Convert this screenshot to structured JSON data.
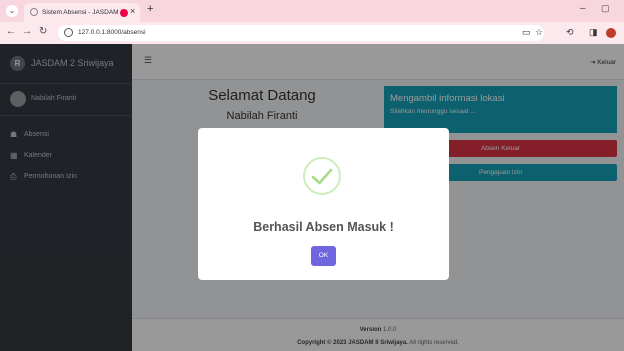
{
  "browser": {
    "tab_title": "Sistem Absensi - JASDAM I",
    "url": "127.0.0.1:8000/absensi",
    "new_tab_glyph": "+",
    "close_glyph": "×"
  },
  "sidebar": {
    "brand": "JASDAM 2 Sriwijaya",
    "brand_logo": "R",
    "user": "Nabilah Firanti",
    "items": [
      {
        "label": "Absensi",
        "icon": "users-icon",
        "glyph": "☗"
      },
      {
        "label": "Kalender",
        "icon": "calendar-icon",
        "glyph": "▦"
      },
      {
        "label": "Permohonan Izin",
        "icon": "printer-icon",
        "glyph": "⎙"
      }
    ]
  },
  "topnav": {
    "logout_label": "Keluar",
    "logout_glyph": "⇥"
  },
  "welcome": {
    "title": "Selamat Datang",
    "name": "Nabilah Firanti"
  },
  "location_card": {
    "title": "Mengambil informasi lokasi",
    "subtitle": "Silahkan menunggu sesaat ..."
  },
  "buttons": {
    "absen_keluar": "Absen Keluar",
    "pengajuan_izin": "Pengajuan Izin"
  },
  "footer": {
    "version_label": "Version",
    "version_value": "1.0.0",
    "copyright_prefix": "Copyright © 2023",
    "copyright_org": "JASDAM II Sriwijaya.",
    "copyright_suffix": "All rights reserved."
  },
  "modal": {
    "title": "Berhasil Absen Masuk !",
    "ok_label": "OK"
  },
  "colors": {
    "sidebar": "#343a40",
    "info": "#17a2b8",
    "danger": "#dc3545",
    "confirm": "#7066e0",
    "success": "#a5dc86"
  }
}
